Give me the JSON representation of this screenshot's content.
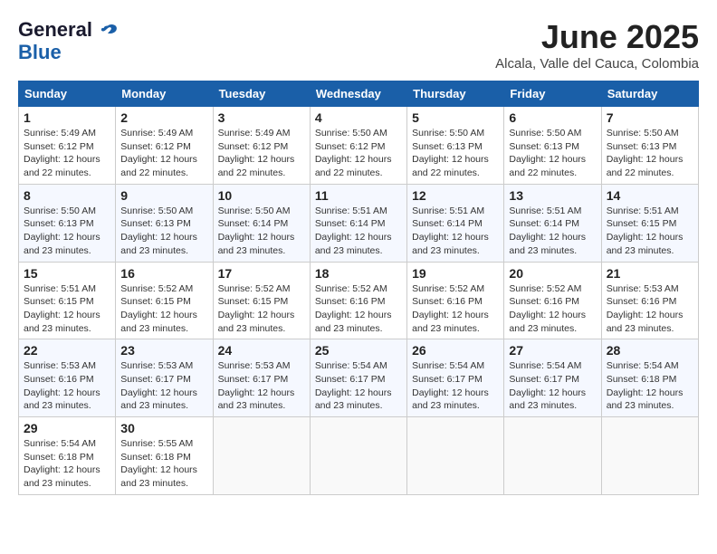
{
  "logo": {
    "line1": "General",
    "line2": "Blue"
  },
  "title": "June 2025",
  "subtitle": "Alcala, Valle del Cauca, Colombia",
  "weekdays": [
    "Sunday",
    "Monday",
    "Tuesday",
    "Wednesday",
    "Thursday",
    "Friday",
    "Saturday"
  ],
  "weeks": [
    [
      {
        "day": "1",
        "rise": "5:49 AM",
        "set": "6:12 PM",
        "daylight": "12 hours and 22 minutes."
      },
      {
        "day": "2",
        "rise": "5:49 AM",
        "set": "6:12 PM",
        "daylight": "12 hours and 22 minutes."
      },
      {
        "day": "3",
        "rise": "5:49 AM",
        "set": "6:12 PM",
        "daylight": "12 hours and 22 minutes."
      },
      {
        "day": "4",
        "rise": "5:50 AM",
        "set": "6:12 PM",
        "daylight": "12 hours and 22 minutes."
      },
      {
        "day": "5",
        "rise": "5:50 AM",
        "set": "6:13 PM",
        "daylight": "12 hours and 22 minutes."
      },
      {
        "day": "6",
        "rise": "5:50 AM",
        "set": "6:13 PM",
        "daylight": "12 hours and 22 minutes."
      },
      {
        "day": "7",
        "rise": "5:50 AM",
        "set": "6:13 PM",
        "daylight": "12 hours and 22 minutes."
      }
    ],
    [
      {
        "day": "8",
        "rise": "5:50 AM",
        "set": "6:13 PM",
        "daylight": "12 hours and 23 minutes."
      },
      {
        "day": "9",
        "rise": "5:50 AM",
        "set": "6:13 PM",
        "daylight": "12 hours and 23 minutes."
      },
      {
        "day": "10",
        "rise": "5:50 AM",
        "set": "6:14 PM",
        "daylight": "12 hours and 23 minutes."
      },
      {
        "day": "11",
        "rise": "5:51 AM",
        "set": "6:14 PM",
        "daylight": "12 hours and 23 minutes."
      },
      {
        "day": "12",
        "rise": "5:51 AM",
        "set": "6:14 PM",
        "daylight": "12 hours and 23 minutes."
      },
      {
        "day": "13",
        "rise": "5:51 AM",
        "set": "6:14 PM",
        "daylight": "12 hours and 23 minutes."
      },
      {
        "day": "14",
        "rise": "5:51 AM",
        "set": "6:15 PM",
        "daylight": "12 hours and 23 minutes."
      }
    ],
    [
      {
        "day": "15",
        "rise": "5:51 AM",
        "set": "6:15 PM",
        "daylight": "12 hours and 23 minutes."
      },
      {
        "day": "16",
        "rise": "5:52 AM",
        "set": "6:15 PM",
        "daylight": "12 hours and 23 minutes."
      },
      {
        "day": "17",
        "rise": "5:52 AM",
        "set": "6:15 PM",
        "daylight": "12 hours and 23 minutes."
      },
      {
        "day": "18",
        "rise": "5:52 AM",
        "set": "6:16 PM",
        "daylight": "12 hours and 23 minutes."
      },
      {
        "day": "19",
        "rise": "5:52 AM",
        "set": "6:16 PM",
        "daylight": "12 hours and 23 minutes."
      },
      {
        "day": "20",
        "rise": "5:52 AM",
        "set": "6:16 PM",
        "daylight": "12 hours and 23 minutes."
      },
      {
        "day": "21",
        "rise": "5:53 AM",
        "set": "6:16 PM",
        "daylight": "12 hours and 23 minutes."
      }
    ],
    [
      {
        "day": "22",
        "rise": "5:53 AM",
        "set": "6:16 PM",
        "daylight": "12 hours and 23 minutes."
      },
      {
        "day": "23",
        "rise": "5:53 AM",
        "set": "6:17 PM",
        "daylight": "12 hours and 23 minutes."
      },
      {
        "day": "24",
        "rise": "5:53 AM",
        "set": "6:17 PM",
        "daylight": "12 hours and 23 minutes."
      },
      {
        "day": "25",
        "rise": "5:54 AM",
        "set": "6:17 PM",
        "daylight": "12 hours and 23 minutes."
      },
      {
        "day": "26",
        "rise": "5:54 AM",
        "set": "6:17 PM",
        "daylight": "12 hours and 23 minutes."
      },
      {
        "day": "27",
        "rise": "5:54 AM",
        "set": "6:17 PM",
        "daylight": "12 hours and 23 minutes."
      },
      {
        "day": "28",
        "rise": "5:54 AM",
        "set": "6:18 PM",
        "daylight": "12 hours and 23 minutes."
      }
    ],
    [
      {
        "day": "29",
        "rise": "5:54 AM",
        "set": "6:18 PM",
        "daylight": "12 hours and 23 minutes."
      },
      {
        "day": "30",
        "rise": "5:55 AM",
        "set": "6:18 PM",
        "daylight": "12 hours and 23 minutes."
      },
      null,
      null,
      null,
      null,
      null
    ]
  ]
}
